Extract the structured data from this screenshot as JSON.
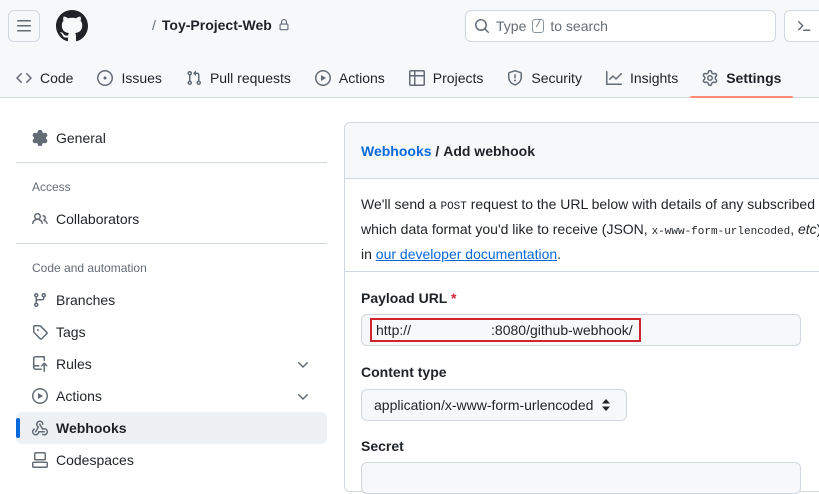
{
  "header": {
    "repo_slash": "/",
    "repo_name": "Toy-Project-Web",
    "search_prefix": "Type",
    "search_key": "/",
    "search_suffix": "to search"
  },
  "tabs": [
    {
      "label": "Code",
      "icon": "code-icon"
    },
    {
      "label": "Issues",
      "icon": "issue-icon"
    },
    {
      "label": "Pull requests",
      "icon": "pull-request-icon"
    },
    {
      "label": "Actions",
      "icon": "play-icon"
    },
    {
      "label": "Projects",
      "icon": "table-icon"
    },
    {
      "label": "Security",
      "icon": "shield-icon"
    },
    {
      "label": "Insights",
      "icon": "graph-icon"
    },
    {
      "label": "Settings",
      "icon": "gear-icon"
    }
  ],
  "sidebar": {
    "general": "General",
    "access_heading": "Access",
    "collaborators": "Collaborators",
    "code_heading": "Code and automation",
    "branches": "Branches",
    "tags": "Tags",
    "rules": "Rules",
    "actions": "Actions",
    "webhooks": "Webhooks",
    "codespaces": "Codespaces"
  },
  "panel": {
    "breadcrumb_link": "Webhooks",
    "breadcrumb_sep": " / ",
    "breadcrumb_current": "Add webhook",
    "intro_line1_a": "We'll send a ",
    "intro_line1_code": "POST",
    "intro_line1_b": " request to the URL below with details of any subscribed e",
    "intro_line2_a": "which data format you'd like to receive (JSON, ",
    "intro_line2_code": "x-www-form-urlencoded",
    "intro_line2_b": ", ",
    "intro_line2_etc": "etc",
    "intro_line2_c": ").",
    "intro_line3_a": "in ",
    "intro_line3_link": "our developer documentation",
    "intro_line3_b": ".",
    "payload_label": "Payload URL",
    "payload_required": "*",
    "payload_prefix": "http://",
    "payload_suffix": ":8080/github-webhook/",
    "content_type_label": "Content type",
    "content_type_value": "application/x-www-form-urlencoded",
    "secret_label": "Secret"
  },
  "colors": {
    "accent": "#0969da",
    "tab_underline": "#fd8c73",
    "highlight_box": "#d1242f"
  }
}
